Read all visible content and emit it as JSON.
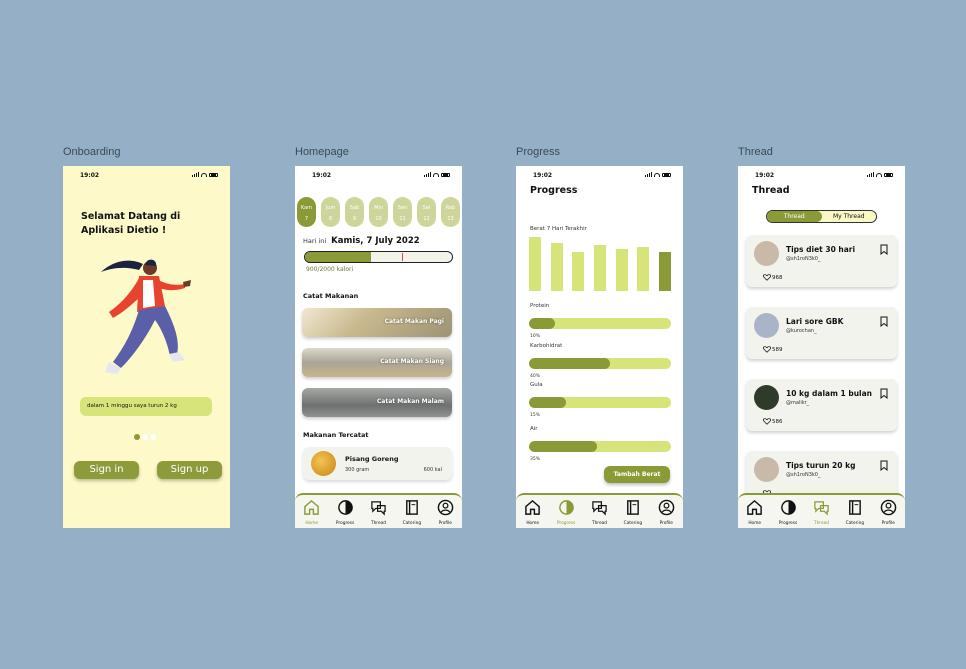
{
  "frames": {
    "onboarding": "Onboarding",
    "homepage": "Homepage",
    "progress": "Progress",
    "thread": "Thread"
  },
  "status_time": "19:02",
  "onboarding": {
    "title": "Selamat Datang di Aplikasi Dietio !",
    "banner": "dalam 1 minggu saya turun 2 kg",
    "signin": "Sign in",
    "signup": "Sign up",
    "page_indicator": {
      "total": 3,
      "active": 1
    }
  },
  "homepage": {
    "days": [
      {
        "d": "Kam",
        "n": "7",
        "active": true
      },
      {
        "d": "Jum",
        "n": "8",
        "active": false
      },
      {
        "d": "Sab",
        "n": "9",
        "active": false
      },
      {
        "d": "Min",
        "n": "10",
        "active": false
      },
      {
        "d": "Sen",
        "n": "11",
        "active": false
      },
      {
        "d": "Sel",
        "n": "12",
        "active": false
      },
      {
        "d": "Rab",
        "n": "13",
        "active": false
      }
    ],
    "today_prefix": "Hari ini",
    "today_date": "Kamis, 7 July 2022",
    "calories_text": "900/2000 kalori",
    "calories_fraction": 0.45,
    "catat_title": "Catat Makanan",
    "meals": [
      "Catat Makan Pagi",
      "Catat Makan Siang",
      "Catat Makan Malam"
    ],
    "tercatat_title": "Makanan Tercatat",
    "food": {
      "name": "Pisang Goreng",
      "gram": "300 gram",
      "kcal": "600 kal"
    }
  },
  "progress": {
    "title": "Progress",
    "chart_label": "Berat 7 Hari Terakhir",
    "chart_bars": [
      50,
      44,
      36,
      43,
      39,
      41,
      36
    ],
    "nutrients": [
      {
        "name": "Protein",
        "pct": "10%",
        "fill": 0.18
      },
      {
        "name": "Karbohidrat",
        "pct": "40%",
        "fill": 0.57
      },
      {
        "name": "Gula",
        "pct": "15%",
        "fill": 0.26
      },
      {
        "name": "Air",
        "pct": "35%",
        "fill": 0.48
      }
    ],
    "button": "Tambah Berat"
  },
  "thread": {
    "title": "Thread",
    "tabs": [
      "Thread",
      "My Thread"
    ],
    "posts": [
      {
        "title": "Tips diet 30 hari",
        "user": "@sh1roN3k0_",
        "likes": "968",
        "avatar": "#c9b9a8"
      },
      {
        "title": "Lari sore GBK",
        "user": "@kurochan_",
        "likes": "589",
        "avatar": "#aab4c8"
      },
      {
        "title": "10 kg dalam 1 bulan",
        "user": "@malikr_",
        "likes": "586",
        "avatar": "#2e3b2a"
      },
      {
        "title": "Tips turun 20 kg",
        "user": "@sh1roN3k0_",
        "likes": "",
        "avatar": "#c9b9a8"
      }
    ]
  },
  "nav": [
    "Home",
    "Progress",
    "Thread",
    "Catering",
    "Profile"
  ],
  "colors": {
    "accent": "#8a9a36",
    "light_accent": "#d6e47a",
    "bg": "#94afc6",
    "onboarding_bg": "#fdf9c9"
  }
}
